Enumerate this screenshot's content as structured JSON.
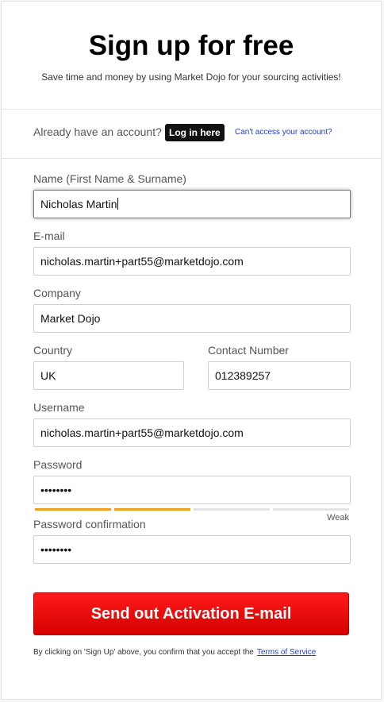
{
  "header": {
    "title": "Sign up for free",
    "subtitle": "Save time and money by using Market Dojo for your sourcing activities!"
  },
  "account": {
    "prompt": "Already have an account?",
    "login_label": "Log in here",
    "cant_access": "Can't access your account?"
  },
  "form": {
    "name_label": "Name (First Name & Surname)",
    "name_value": "Nicholas Martin",
    "email_label": "E-mail",
    "email_value": "nicholas.martin+part55@marketdojo.com",
    "company_label": "Company",
    "company_value": "Market Dojo",
    "country_label": "Country",
    "country_value": "UK",
    "contact_label": "Contact Number",
    "contact_value": "012389257",
    "username_label": "Username",
    "username_value": "nicholas.martin+part55@marketdojo.com",
    "password_label": "Password",
    "password_value": "••••••••",
    "password_strength": {
      "label": "Weak",
      "filled_segments": 2,
      "total_segments": 4,
      "filled_color": "#f0a01e",
      "empty_color": "#e3e3e3"
    },
    "password_confirm_label": "Password confirmation",
    "password_confirm_value": "••••••••"
  },
  "submit": {
    "label": "Send out Activation E-mail",
    "color": "#e60000"
  },
  "footer": {
    "terms_text": "By clicking on 'Sign Up' above, you confirm that you accept the",
    "terms_link": "Terms of Service"
  }
}
